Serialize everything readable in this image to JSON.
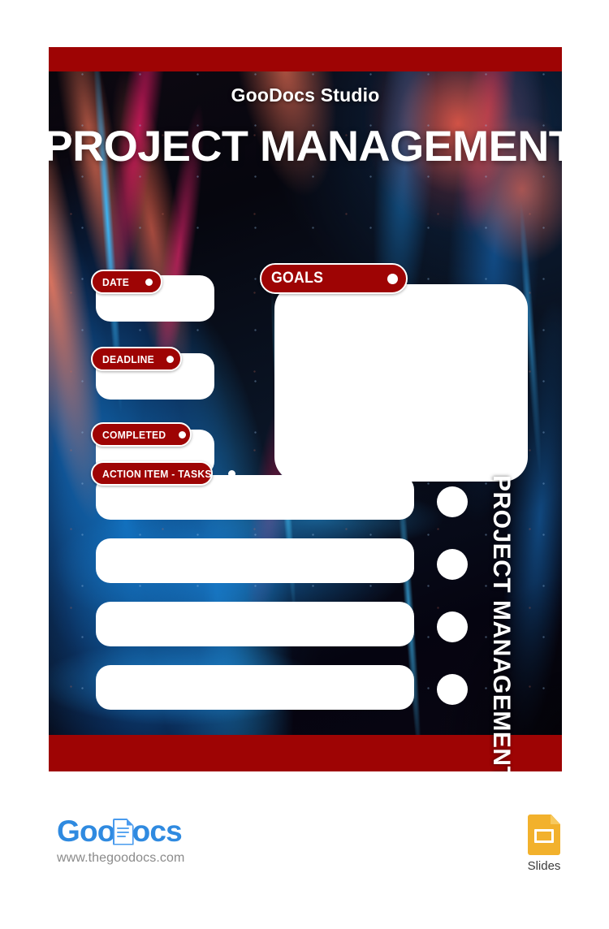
{
  "poster": {
    "studio_name": "GooDocs Studio",
    "title": "PROJECT MANAGEMENT",
    "vertical_title": "PROJECT MANAGEMENT",
    "accent_red": "#9E0404",
    "frame_red": "#9E0404",
    "field_white": "#FFFFFF",
    "labels": {
      "date": "DATE",
      "deadline": "DEADLINE",
      "completed": "COMPLETED",
      "goals": "GOALS",
      "action_items": "ACTION ITEM - TASKS"
    },
    "fields": {
      "date_value": "",
      "deadline_value": "",
      "completed_value": "",
      "goals_value": "",
      "tasks": [
        "",
        "",
        "",
        ""
      ]
    },
    "task_markers": [
      "",
      "",
      "",
      ""
    ]
  },
  "footer": {
    "brand_part1": "Goo",
    "brand_part2": "ocs",
    "website": "www.thegoodocs.com",
    "format_label": "Slides",
    "brand_blue": "#2F8AE0",
    "slides_yellow": "#F2B12C"
  }
}
